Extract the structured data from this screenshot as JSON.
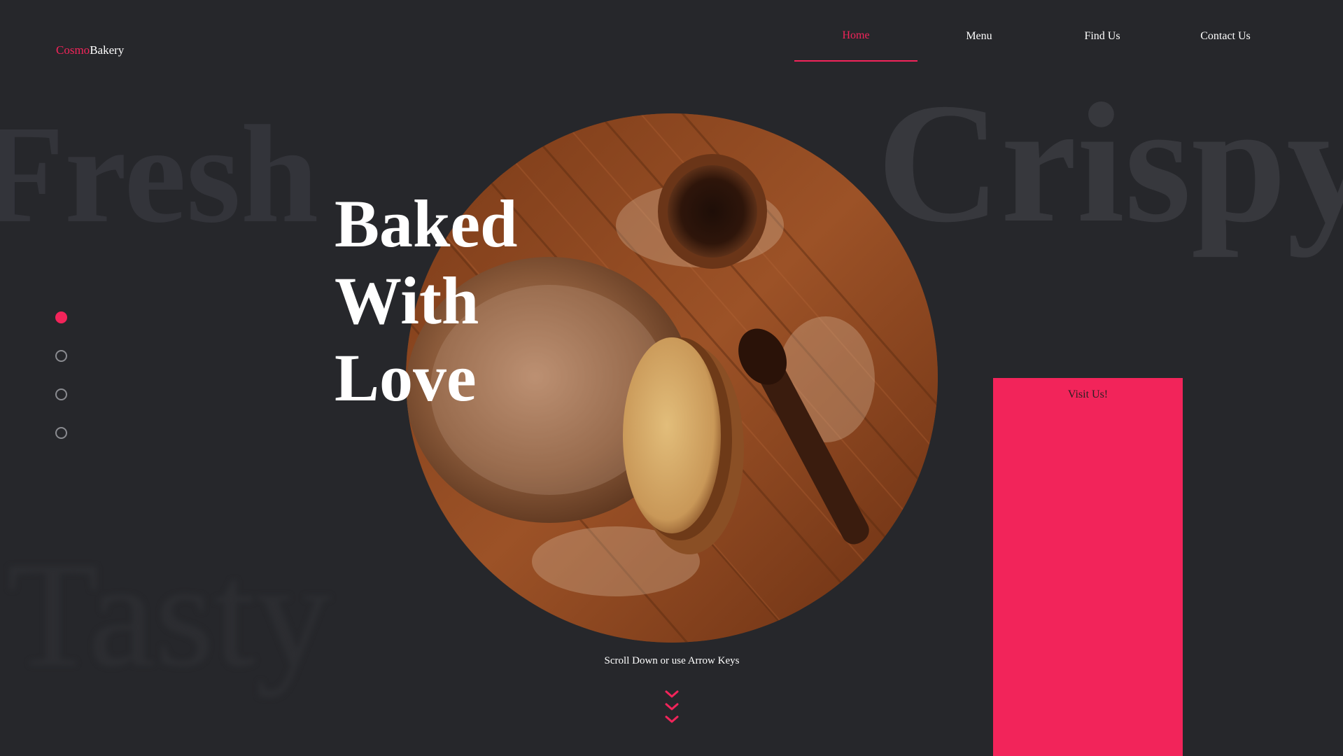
{
  "brand": {
    "prefix": "Cosmo",
    "suffix": "Bakery"
  },
  "nav": {
    "items": [
      {
        "label": "Home",
        "active": true
      },
      {
        "label": "Menu",
        "active": false
      },
      {
        "label": "Find Us",
        "active": false
      },
      {
        "label": "Contact Us",
        "active": false
      }
    ]
  },
  "background_words": {
    "left_top": "Fresh",
    "right_top": "Crispy",
    "left_bottom": "Tasty"
  },
  "hero": {
    "line1": "Baked",
    "line2": "With",
    "line3": "Love"
  },
  "pagination": {
    "count": 4,
    "active_index": 0
  },
  "scroll_hint": "Scroll Down or use Arrow Keys",
  "visit_panel": {
    "label": "Visit Us!"
  },
  "colors": {
    "background": "#26272b",
    "accent": "#f2245a",
    "text": "#ffffff"
  },
  "icons": {
    "scroll": "triple-chevron-down-icon"
  }
}
